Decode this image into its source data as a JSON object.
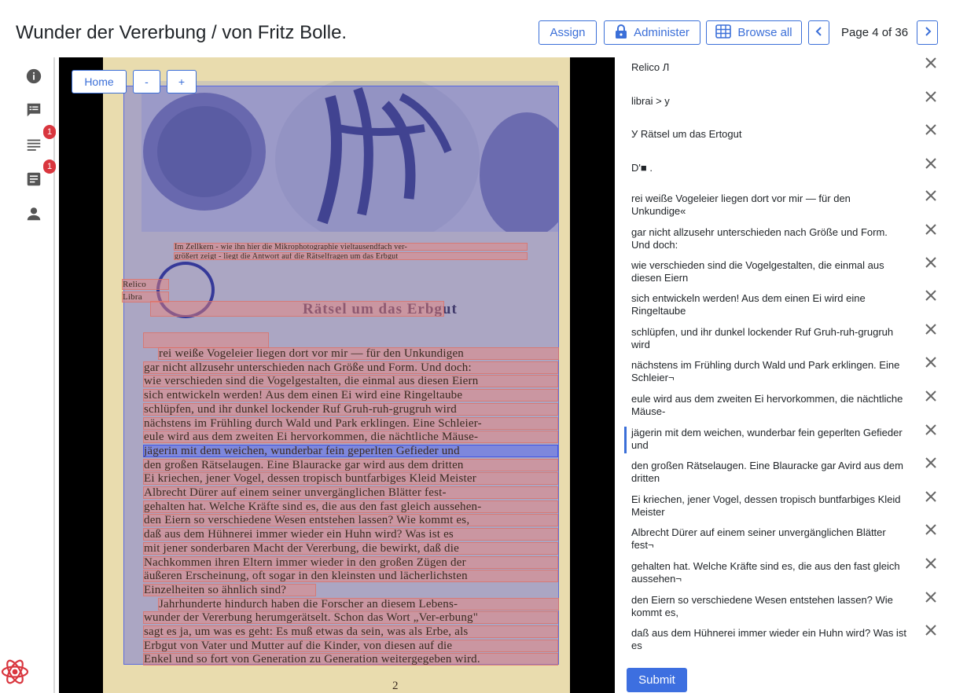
{
  "header": {
    "title": "Wunder der Vererbung / von Fritz Bolle.",
    "assign_label": "Assign",
    "administer_label": "Administer",
    "browse_label": "Browse all",
    "page_indicator": "Page 4 of 36"
  },
  "sidebar": {
    "items": [
      {
        "name": "info",
        "badge": ""
      },
      {
        "name": "comments",
        "badge": ""
      },
      {
        "name": "transcription",
        "badge": "1"
      },
      {
        "name": "notes",
        "badge": "1"
      },
      {
        "name": "user",
        "badge": ""
      }
    ]
  },
  "viewer": {
    "home_label": "Home",
    "zoom_out_label": "-",
    "zoom_in_label": "+",
    "caption_1": "Im Zellkern - wie ihn hier die Mikrophotographie vieltausendfach ver-",
    "caption_2": "größert zeigt - liegt die Antwort auf die Rätselfragen um das Erbgut",
    "heading": "Rätsel um das Erbgut",
    "stamp_1": "Relico",
    "stamp_2": "Libra",
    "page_number": "2",
    "scan_lines": [
      "rei weiße Vogeleier liegen dort vor mir — für den Unkundigen",
      "gar nicht allzusehr unterschieden nach Größe und Form. Und doch:",
      "wie verschieden sind die Vogelgestalten, die einmal aus diesen Eiern",
      "sich entwickeln werden! Aus dem einen Ei wird eine Ringeltaube",
      "schlüpfen, und ihr dunkel lockender Ruf Gruh-ruh-grugruh wird",
      "nächstens im Frühling durch Wald und Park erklingen. Eine Schleier-",
      "eule wird aus dem zweiten Ei hervorkommen, die nächtliche Mäuse-",
      "jägerin mit dem weichen, wunderbar fein geperlten Gefieder und",
      "den großen Rätselaugen. Eine Blauracke gar wird aus dem dritten",
      "Ei kriechen, jener Vogel, dessen tropisch buntfarbiges Kleid Meister",
      "Albrecht Dürer auf einem seiner unvergänglichen Blätter fest-",
      "gehalten hat. Welche Kräfte sind es, die aus den fast gleich aussehen-",
      "den Eiern so verschiedene Wesen entstehen lassen? Wie kommt es,",
      "daß aus dem Hühnerei immer wieder ein Huhn wird? Was ist es",
      "mit jener sonderbaren Macht der Vererbung, die bewirkt, daß die",
      "Nachkommen ihren Eltern immer wieder in den großen Zügen der",
      "äußeren Erscheinung, oft sogar in den kleinsten und lächerlichsten",
      "Einzelheiten so ähnlich sind?",
      "Jahrhunderte hindurch haben die Forscher an diesem Lebens-",
      "wunder der Vererbung herumgerätselt. Schon das Wort „Ver-erbung\"",
      "sagt es ja, um was es geht: Es muß etwas da sein, was als Erbe, als",
      "Erbgut von Vater und Mutter auf die Kinder, von diesen auf die",
      "Enkel und so fort von Generation zu Generation weitergegeben wird."
    ]
  },
  "transcriptions": [
    "Relico Л",
    "librai > y",
    "У Rätsel um das Ertogut",
    "D'■ .",
    "rei weiße Vogeleier liegen dort vor mir — für den Unkundige«",
    "gar nicht allzusehr unterschieden nach Größe und Form. Und doch:",
    "wie verschieden sind die Vogelgestalten, die einmal aus diesen Eiern",
    "sich entwickeln werden! Aus dem einen Ei wird eine Ringeltaube",
    "schlüpfen, und ihr dunkel lockender Ruf Gruh-ruh-grugruh wird",
    "nächstens im Frühling durch Wald und Park erklingen. Eine Schleier¬",
    "eule wird aus dem zweiten Ei hervorkommen, die nächtliche Mäuse-",
    "jägerin mit dem weichen, wunderbar fein geperlten Gefieder und",
    "den großen Rätselaugen. Eine Blauracke gar Avird aus dem dritten",
    "Ei kriechen, jener Vogel, dessen tropisch buntfarbiges Kleid Meister",
    "Albrecht Dürer auf einem seiner unvergänglichen Blätter fest¬",
    "gehalten hat. Welche Kräfte sind es, die aus den fast gleich aussehen¬",
    "den Eiern so verschiedene Wesen entstehen lassen? Wie kommt es,",
    "daß aus dem Hühnerei immer wieder ein Huhn wird? Was ist es"
  ],
  "submit_label": "Submit",
  "colors": {
    "accent": "#3b6fd8",
    "badge": "#d9363e",
    "line_overlay": "#f08278",
    "region_overlay": "#4650e6"
  }
}
